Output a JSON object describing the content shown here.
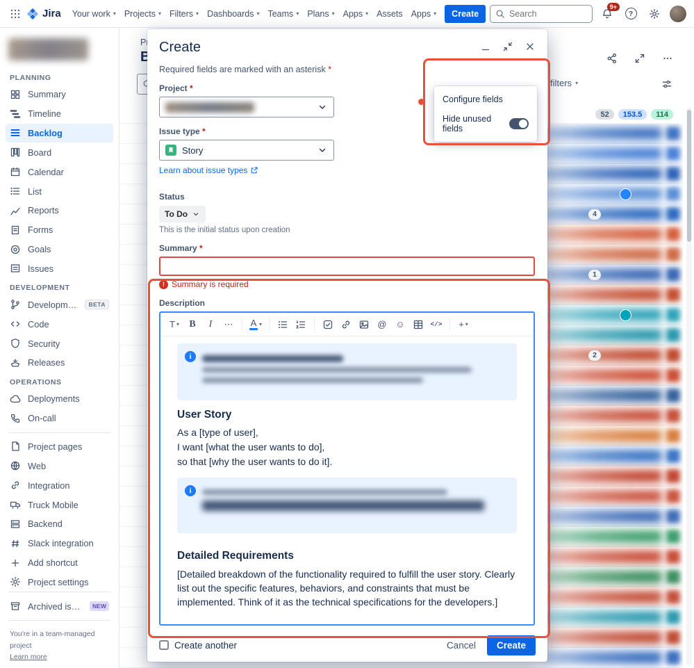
{
  "glyphs": {
    "chevron_down": "▾",
    "more_h": "⋯",
    "help": "?",
    "info": "i",
    "at": "@",
    "smile": "☺",
    "plus": "+",
    "bold": "B",
    "italic": "I",
    "text_style": "T",
    "color_a": "A",
    "code": "</>",
    "error": "!"
  },
  "topnav": {
    "logo_text": "Jira",
    "items": [
      {
        "label": "Your work",
        "chevron": true
      },
      {
        "label": "Projects",
        "chevron": true
      },
      {
        "label": "Filters",
        "chevron": true
      },
      {
        "label": "Dashboards",
        "chevron": true
      },
      {
        "label": "Teams",
        "chevron": true
      },
      {
        "label": "Plans",
        "chevron": true
      },
      {
        "label": "Apps",
        "chevron": true
      },
      {
        "label": "Assets",
        "chevron": false
      },
      {
        "label": "Apps",
        "chevron": true
      }
    ],
    "create_button": "Create",
    "search_placeholder": "Search",
    "notification_badge": "9+"
  },
  "sidebar": {
    "sections": [
      {
        "heading": "PLANNING",
        "items": [
          {
            "label": "Summary"
          },
          {
            "label": "Timeline"
          },
          {
            "label": "Backlog"
          },
          {
            "label": "Board"
          },
          {
            "label": "Calendar"
          },
          {
            "label": "List"
          },
          {
            "label": "Reports"
          },
          {
            "label": "Forms"
          },
          {
            "label": "Goals"
          },
          {
            "label": "Issues"
          }
        ]
      },
      {
        "heading": "DEVELOPMENT",
        "items": [
          {
            "label": "Development",
            "badge": "BETA"
          },
          {
            "label": "Code"
          },
          {
            "label": "Security"
          },
          {
            "label": "Releases"
          }
        ]
      },
      {
        "heading": "OPERATIONS",
        "items": [
          {
            "label": "Deployments"
          },
          {
            "label": "On-call"
          }
        ]
      },
      {
        "heading": "",
        "items": [
          {
            "label": "Project pages"
          },
          {
            "label": "Web"
          },
          {
            "label": "Integration"
          },
          {
            "label": "Truck Mobile"
          },
          {
            "label": "Backend"
          },
          {
            "label": "Slack integration"
          },
          {
            "label": "Add shortcut"
          },
          {
            "label": "Project settings"
          }
        ]
      }
    ],
    "archived_label": "Archived issues",
    "archived_badge": "NEW",
    "footer_note": "You're in a team-managed project",
    "footer_link": "Learn more"
  },
  "backlog": {
    "breadcrumb": "Projects /...",
    "title": "Backlog",
    "filters_label": "filters",
    "badges": {
      "todo": "52",
      "in_progress": "153.5",
      "done": "114"
    },
    "rows": [
      {
        "c": "#3f73c2"
      },
      {
        "c": "#4a82d6"
      },
      {
        "c": "#2d63b8"
      },
      {
        "c": "#5b8fd6",
        "av": "#2684ff"
      },
      {
        "c": "#2f6ac0",
        "n": "4"
      },
      {
        "c": "#d4603f"
      },
      {
        "c": "#cf6a45"
      },
      {
        "c": "#3a68b5",
        "n": "1"
      },
      {
        "c": "#c44f33"
      },
      {
        "c": "#2fa3b8",
        "av": "#00a3bf"
      },
      {
        "c": "#2a98ad"
      },
      {
        "c": "#c04a30",
        "n": "2"
      },
      {
        "c": "#cc4f36"
      },
      {
        "c": "#35629e"
      },
      {
        "c": "#c6503a"
      },
      {
        "c": "#d97f3f"
      },
      {
        "c": "#3a74c4"
      },
      {
        "c": "#c24733"
      },
      {
        "c": "#cb5540"
      },
      {
        "c": "#3f6db8"
      },
      {
        "c": "#3f9e6e"
      },
      {
        "c": "#c84e38"
      },
      {
        "c": "#3c8f5f"
      },
      {
        "c": "#c5503b"
      },
      {
        "c": "#2d9aae"
      },
      {
        "c": "#c04c36"
      },
      {
        "c": "#3b6fc0"
      }
    ]
  },
  "dialog": {
    "title": "Create",
    "required_note": "Required fields are marked with an asterisk",
    "asterisk": "*",
    "fields_visible_count": "1",
    "project": {
      "label": "Project"
    },
    "issue_type": {
      "label": "Issue type",
      "value": "Story",
      "learn_link": "Learn about issue types"
    },
    "status": {
      "label": "Status",
      "value": "To Do",
      "help": "This is the initial status upon creation"
    },
    "summary": {
      "label": "Summary",
      "error": "Summary is required"
    },
    "description": {
      "label": "Description",
      "story_heading": "User Story",
      "story_lines": [
        "As a [type of user],",
        "I want [what the user wants to do],",
        "so that [why the user wants to do it]."
      ],
      "req_heading": "Detailed Requirements",
      "req_text": "[Detailed breakdown of the functionality required to fulfill the user story. Clearly list out the specific features, behaviors, and constraints that must be implemented. Think of it as the technical specifications for the developers.]"
    },
    "footer": {
      "create_another": "Create another",
      "cancel": "Cancel",
      "create": "Create"
    }
  },
  "fields_popup": {
    "configure": "Configure fields",
    "hide_unused": "Hide unused fields"
  }
}
